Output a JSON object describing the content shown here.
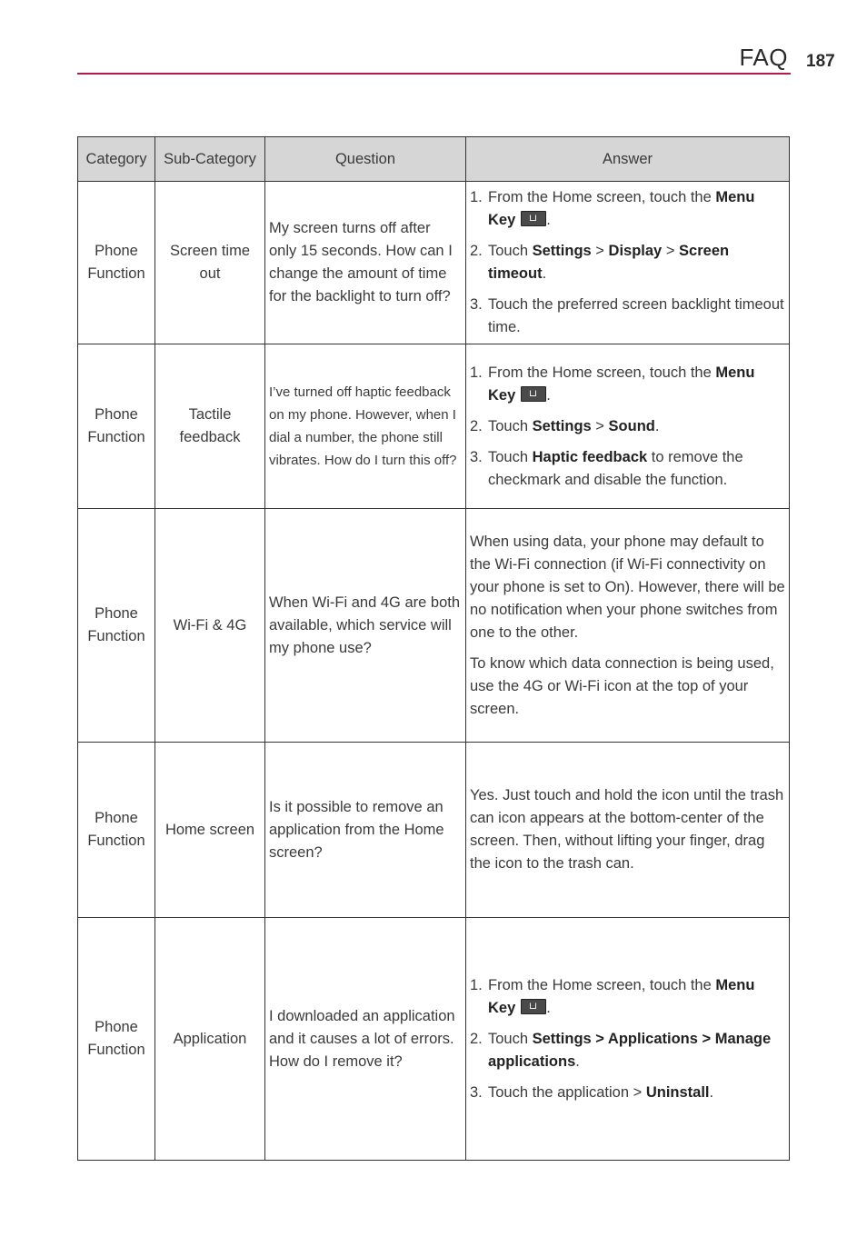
{
  "header": {
    "title": "FAQ",
    "page_number": "187",
    "accent_color": "#b5174f"
  },
  "table": {
    "columns": [
      "Category",
      "Sub-Category",
      "Question",
      "Answer"
    ],
    "rows": [
      {
        "category": "Phone Function",
        "subcategory": "Screen time out",
        "question": "My screen turns off after only 15 seconds. How can I change the amount of time for the backlight to turn off?",
        "steps": [
          {
            "num": "1.",
            "parts": [
              {
                "t": "From the Home screen, touch the "
              },
              {
                "t": "Menu Key",
                "b": true
              },
              {
                "icon": "menu-key-icon"
              },
              {
                "t": "."
              }
            ]
          },
          {
            "num": "2.",
            "parts": [
              {
                "t": "Touch "
              },
              {
                "t": "Settings",
                "b": true
              },
              {
                "t": " > "
              },
              {
                "t": "Display",
                "b": true
              },
              {
                "t": " > "
              },
              {
                "t": "Screen timeout",
                "b": true
              },
              {
                "t": "."
              }
            ]
          },
          {
            "num": "3.",
            "parts": [
              {
                "t": "Touch the preferred screen backlight timeout time."
              }
            ]
          }
        ]
      },
      {
        "category": "Phone Function",
        "subcategory": "Tactile feedback",
        "question": "I’ve turned off haptic feedback on my phone. However, when I dial a number, the phone still vibrates. How do I turn this off?",
        "steps": [
          {
            "num": "1.",
            "parts": [
              {
                "t": "From the Home screen, touch the "
              },
              {
                "t": "Menu Key",
                "b": true
              },
              {
                "icon": "menu-key-icon"
              },
              {
                "t": "."
              }
            ]
          },
          {
            "num": "2.",
            "parts": [
              {
                "t": "Touch "
              },
              {
                "t": "Settings",
                "b": true
              },
              {
                "t": " > "
              },
              {
                "t": "Sound",
                "b": true
              },
              {
                "t": "."
              }
            ]
          },
          {
            "num": "3.",
            "parts": [
              {
                "t": "Touch "
              },
              {
                "t": "Haptic feedback",
                "b": true
              },
              {
                "t": " to remove the checkmark and disable the function."
              }
            ]
          }
        ]
      },
      {
        "category": "Phone Function",
        "subcategory": "Wi-Fi & 4G",
        "question": "When Wi-Fi and 4G are both available, which service will my phone use?",
        "paragraphs": [
          "When using data, your phone may default to the Wi-Fi connection (if Wi-Fi connectivity on your phone is set to On). However, there will be no notification when your phone switches from one to the other.",
          "To know which data connection is being used, use the 4G or Wi-Fi icon at the top of your screen."
        ]
      },
      {
        "category": "Phone Function",
        "subcategory": "Home screen",
        "question": "Is it possible to remove an application from the Home screen?",
        "paragraphs": [
          "Yes. Just touch and hold the icon until the trash can icon appears at the bottom-center of the screen. Then, without lifting your finger, drag the icon to the trash can."
        ]
      },
      {
        "category": "Phone Function",
        "subcategory": "Application",
        "question": "I downloaded an application and it causes a lot of errors. How do I remove it?",
        "steps": [
          {
            "num": "1.",
            "parts": [
              {
                "t": "From the Home screen, touch the "
              },
              {
                "t": "Menu Key",
                "b": true
              },
              {
                "icon": "menu-key-icon"
              },
              {
                "t": "."
              }
            ]
          },
          {
            "num": "2.",
            "parts": [
              {
                "t": "Touch "
              },
              {
                "t": "Settings > Applications > Manage applications",
                "b": true
              },
              {
                "t": "."
              }
            ]
          },
          {
            "num": "3.",
            "parts": [
              {
                "t": "Touch the application > "
              },
              {
                "t": "Uninstall",
                "b": true
              },
              {
                "t": "."
              }
            ]
          }
        ]
      }
    ]
  }
}
